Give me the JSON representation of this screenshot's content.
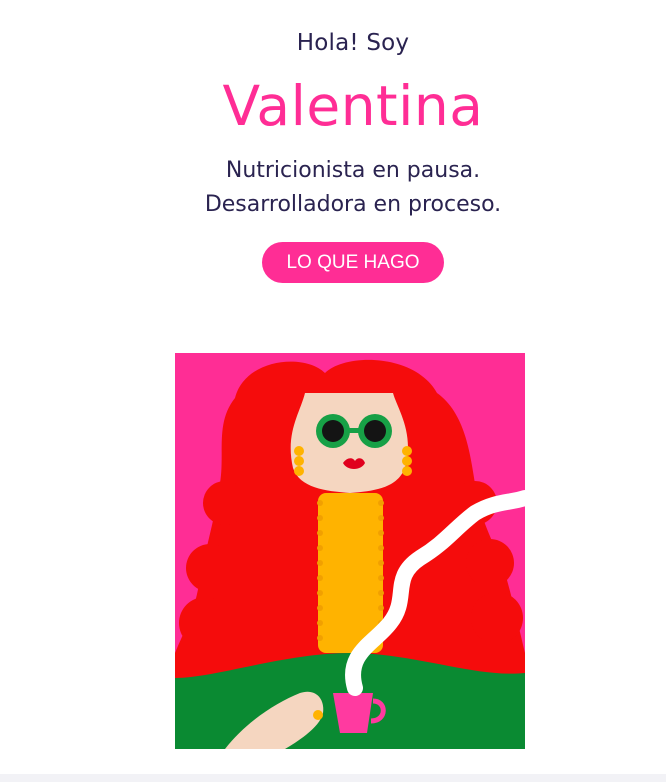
{
  "hero": {
    "greeting": "Hola! Soy",
    "name": "Valentina",
    "tagline_line1": "Nutricionista en pausa.",
    "tagline_line2": "Desarrolladora en proceso.",
    "cta_label": "LO QUE HAGO"
  },
  "illustration": {
    "icon": "woman-with-coffee-illustration"
  },
  "colors": {
    "accent": "#ff2d95",
    "text": "#2a2350",
    "hair": "#f50c0c",
    "sweater": "#ffb300",
    "dress": "#0a8a32",
    "skin": "#f5d6c0",
    "glasses": "#17a046"
  }
}
